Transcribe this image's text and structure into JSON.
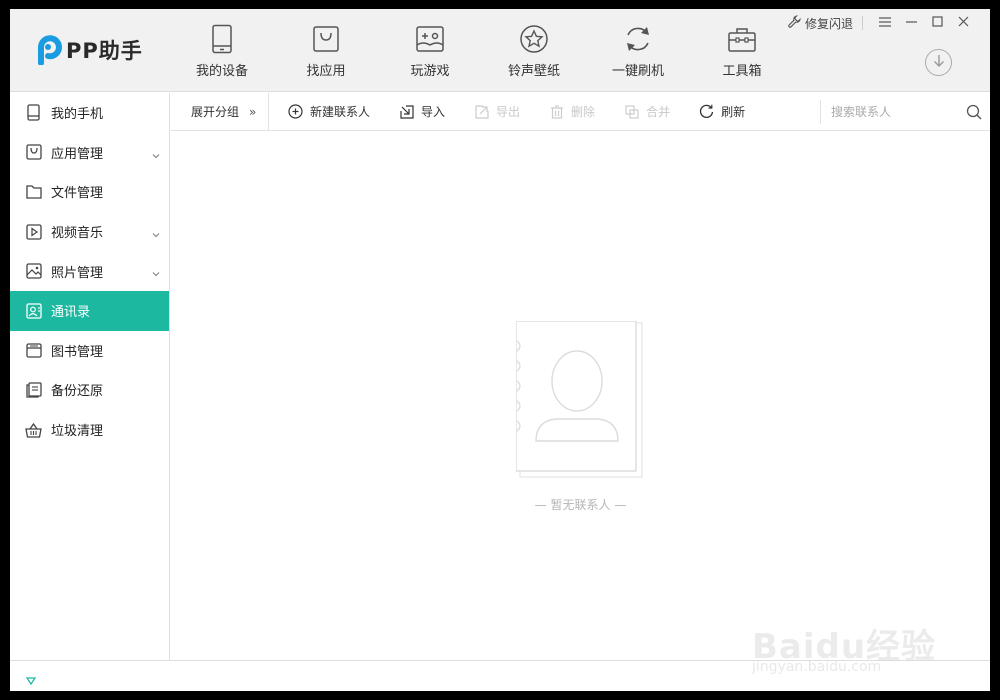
{
  "app": {
    "logo_text": "PP助手",
    "brand_color": "#1db8a0",
    "logo_color": "#1a9de0"
  },
  "topnav": {
    "items": [
      {
        "label": "我的设备",
        "icon": "phone-icon"
      },
      {
        "label": "找应用",
        "icon": "shopping-bag-icon"
      },
      {
        "label": "玩游戏",
        "icon": "gamepad-icon"
      },
      {
        "label": "铃声壁纸",
        "icon": "star-icon"
      },
      {
        "label": "一键刷机",
        "icon": "refresh-icon"
      },
      {
        "label": "工具箱",
        "icon": "toolbox-icon"
      }
    ]
  },
  "window_controls": {
    "repair_label": "修复闪退"
  },
  "sidebar": {
    "active_index": 5,
    "items": [
      {
        "label": "我的手机",
        "icon": "phone-icon",
        "expandable": false
      },
      {
        "label": "应用管理",
        "icon": "app-bag-icon",
        "expandable": true
      },
      {
        "label": "文件管理",
        "icon": "folder-icon",
        "expandable": false
      },
      {
        "label": "视频音乐",
        "icon": "play-icon",
        "expandable": true
      },
      {
        "label": "照片管理",
        "icon": "photo-icon",
        "expandable": true
      },
      {
        "label": "通讯录",
        "icon": "contact-card-icon",
        "expandable": false
      },
      {
        "label": "图书管理",
        "icon": "book-icon",
        "expandable": false
      },
      {
        "label": "备份还原",
        "icon": "backup-icon",
        "expandable": false
      },
      {
        "label": "垃圾清理",
        "icon": "basket-icon",
        "expandable": false
      }
    ]
  },
  "toolbar": {
    "expand_label": "展开分组",
    "expand_arrow": "»",
    "new_contact": "新建联系人",
    "import": "导入",
    "export": "导出",
    "delete": "删除",
    "merge": "合并",
    "refresh": "刷新",
    "search_placeholder": "搜索联系人"
  },
  "content": {
    "empty_text": "— 暂无联系人 —"
  },
  "watermark": {
    "brand": "Baidu经验",
    "url": "jingyan.baidu.com"
  }
}
